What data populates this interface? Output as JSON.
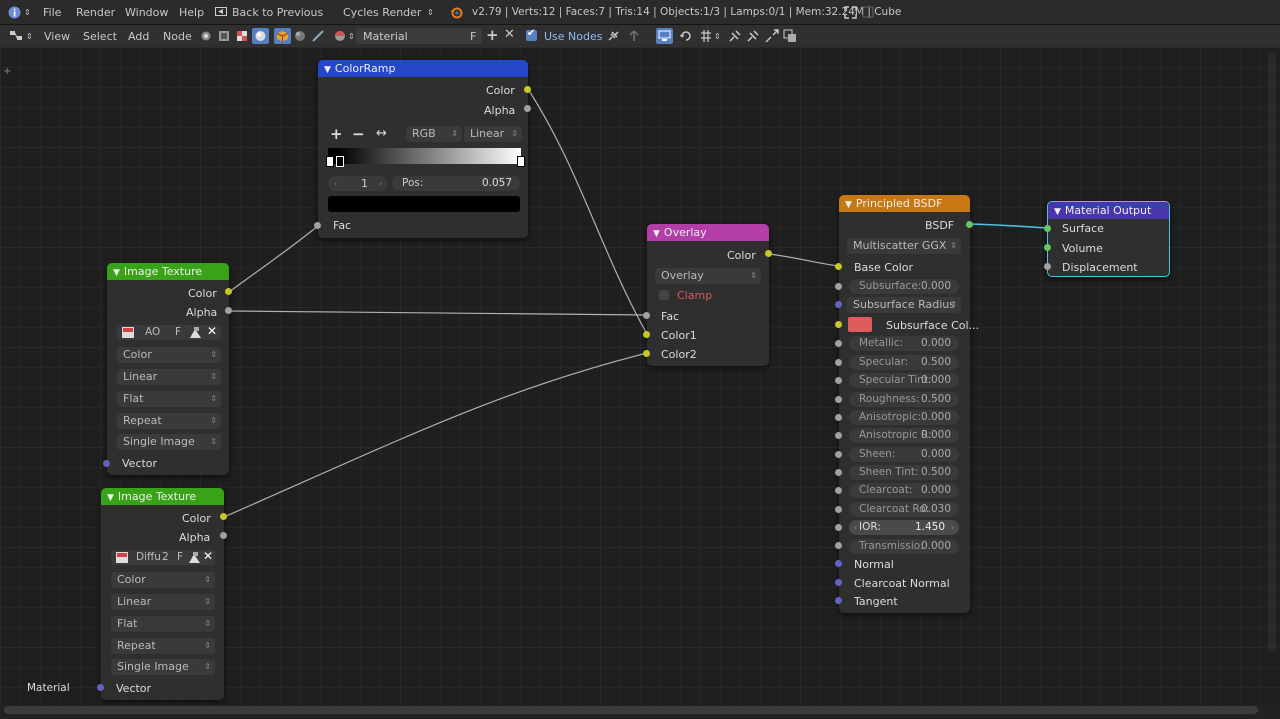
{
  "topbar": {
    "menus": [
      "File",
      "Render",
      "Window",
      "Help"
    ],
    "back_label": "Back to Previous",
    "render_engine": "Cycles Render",
    "stats": "v2.79 | Verts:12 | Faces:7 | Tris:14 | Objects:1/3 | Lamps:0/1 | Mem:32.24M | Cube"
  },
  "toolbar": {
    "menus": [
      "View",
      "Select",
      "Add",
      "Node"
    ],
    "material_name": "Material",
    "fake_user": "F",
    "use_nodes_label": "Use Nodes"
  },
  "colors": {
    "colorramp_header": "#2547c9",
    "image_texture_header": "#39a317",
    "overlay_header": "#b43ea8",
    "principled_header": "#c77813",
    "output_header": "#4b35ad",
    "socket_color": "#c7c729",
    "socket_float": "#a1a1a1",
    "socket_vector": "#6363c7",
    "socket_shader": "#63c763",
    "subsurface_color": "#e05b5b"
  },
  "colorramp": {
    "title": "ColorRamp",
    "out_color": "Color",
    "out_alpha": "Alpha",
    "add_btn": "+",
    "remove_btn": "−",
    "flip_btn": "↔",
    "color_mode": "RGB",
    "interpolation": "Linear",
    "active_index": "1",
    "pos_label": "Pos:",
    "pos_value": "0.057",
    "in_fac": "Fac"
  },
  "image_texture_1": {
    "title": "Image Texture",
    "out_color": "Color",
    "out_alpha": "Alpha",
    "image_name": "AO",
    "fake_user": "F",
    "color_space": "Color",
    "interpolation": "Linear",
    "projection": "Flat",
    "extension": "Repeat",
    "source": "Single Image",
    "in_vector": "Vector"
  },
  "image_texture_2": {
    "title": "Image Texture",
    "out_color": "Color",
    "out_alpha": "Alpha",
    "image_name": "Diffu",
    "users": "2",
    "fake_user": "F",
    "color_space": "Color",
    "interpolation": "Linear",
    "projection": "Flat",
    "extension": "Repeat",
    "source": "Single Image",
    "in_vector": "Vector"
  },
  "overlay": {
    "title": "Overlay",
    "out_color": "Color",
    "blend_type": "Overlay",
    "clamp_label": "Clamp",
    "in_fac": "Fac",
    "in_color1": "Color1",
    "in_color2": "Color2"
  },
  "principled": {
    "title": "Principled BSDF",
    "out_bsdf": "BSDF",
    "distribution": "Multiscatter GGX",
    "base_color": "Base Color",
    "subsurface_method": "Subsurface Radius",
    "subsurface_color": "Subsurface Col...",
    "fields": [
      {
        "label": "Subsurface:",
        "value": "0.000"
      },
      {
        "label": "Metallic:",
        "value": "0.000"
      },
      {
        "label": "Specular:",
        "value": "0.500"
      },
      {
        "label": "Specular Tint:",
        "value": "0.000"
      },
      {
        "label": "Roughness:",
        "value": "0.500"
      },
      {
        "label": "Anisotropic:",
        "value": "0.000"
      },
      {
        "label": "Anisotropic R:",
        "value": "0.000"
      },
      {
        "label": "Sheen:",
        "value": "0.000"
      },
      {
        "label": "Sheen Tint:",
        "value": "0.500"
      },
      {
        "label": "Clearcoat:",
        "value": "0.000"
      },
      {
        "label": "Clearcoat Ro:",
        "value": "0.030"
      },
      {
        "label": "IOR:",
        "value": "1.450"
      },
      {
        "label": "Transmissio:",
        "value": "0.000"
      }
    ],
    "in_normal": "Normal",
    "in_clearcoat_normal": "Clearcoat Normal",
    "in_tangent": "Tangent"
  },
  "material_output": {
    "title": "Material Output",
    "in_surface": "Surface",
    "in_volume": "Volume",
    "in_displacement": "Displacement"
  },
  "footer": {
    "material_label": "Material"
  }
}
